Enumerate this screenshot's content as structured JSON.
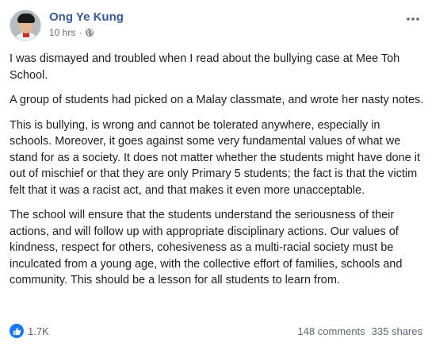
{
  "post": {
    "author": "Ong Ye Kung",
    "time": "10 hrs",
    "separator": "·",
    "privacy_icon": "globe-icon",
    "paragraphs": [
      "I was dismayed and troubled when I read about the bullying case at Mee Toh School.",
      "A group of students had picked on a Malay classmate, and wrote her nasty notes.",
      "This is bullying, is wrong and cannot be tolerated anywhere, especially in schools. Moreover, it goes against some very fundamental values of what we stand for as a society. It does not matter whether the students might have done it out of mischief or that they are only Primary 5 students; the fact is that the victim felt that it was a racist act, and that makes it even more unacceptable.",
      "The school will ensure that the students understand the seriousness of their actions, and will follow up with appropriate disciplinary actions. Our values of kindness, respect for others, cohesiveness as a multi-racial society must be inculcated from a young age, with the collective effort of families, schools and community. This should be a lesson for all students to learn from."
    ]
  },
  "footer": {
    "reaction_icon": "like-icon",
    "reaction_count": "1.7K",
    "comments": "148 comments",
    "shares": "335 shares"
  },
  "colors": {
    "author": "#385898",
    "text": "#1c1e21",
    "meta": "#616770",
    "like": "#1877f2"
  }
}
